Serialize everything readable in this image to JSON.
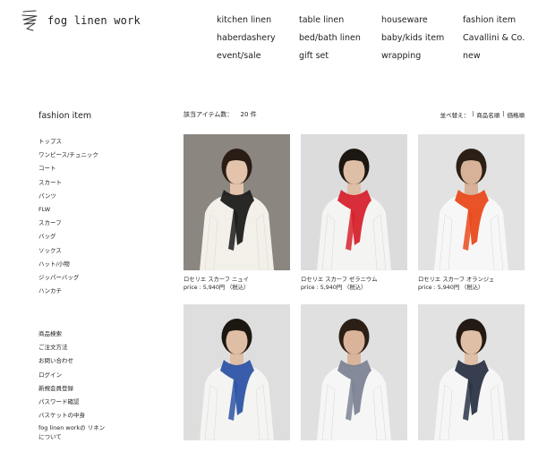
{
  "brand": {
    "name": "fog linen work"
  },
  "nav": [
    "kitchen linen",
    "table linen",
    "houseware",
    "fashion item",
    "haberdashery",
    "bed/bath linen",
    "baby/kids item",
    "Cavallini & Co.",
    "event/sale",
    "gift set",
    "wrapping",
    "new"
  ],
  "sidebar": {
    "title": "fashion item",
    "categories": [
      "トップス",
      "ワンピース/チュニック",
      "コート",
      "スカート",
      "パンツ",
      "FLW",
      "スカーフ",
      "バッグ",
      "ソックス",
      "ハット/小物",
      "ジッパーバッグ",
      "ハンカチ"
    ],
    "utility": [
      "商品検索",
      "ご注文方法",
      "お問い合わせ",
      "ログイン",
      "新規会員登録",
      "パスワード確認",
      "バスケットの中身",
      "fog linen workの リネンについて"
    ]
  },
  "listing": {
    "count_label": "該当アイテム数：",
    "count_value": "20 件",
    "sort_label": "並べ替え：",
    "sort_sep": "|",
    "sort_name": "商品名順",
    "sort_price": "価格順"
  },
  "products": [
    {
      "name": "ロセリエ スカーフ ニュイ",
      "price": "price : 5,940円 （税込）",
      "bg": "#8b8680",
      "shirt": "#f3f0ea",
      "scarf": "#1c1c1c",
      "hair": "#2a1d15",
      "skin": "#e3c3ab",
      "pants": "#f3f0ea"
    },
    {
      "name": "ロセリエ スカーフ ゼラニウム",
      "price": "price : 5,940円 （税込）",
      "bg": "#dcdcdc",
      "shirt": "#f4f4f2",
      "scarf": "#d6232e",
      "hair": "#1d1712",
      "skin": "#dfbea6",
      "pants": "#f4f4f2"
    },
    {
      "name": "ロセリエ スカーフ オランジュ",
      "price": "price : 5,940円 （税込）",
      "bg": "#e2e2e2",
      "shirt": "#f7f7f7",
      "scarf": "#e94a1c",
      "hair": "#2b1f16",
      "skin": "#d7b298",
      "pants": "#3b4b63"
    },
    {
      "name": "",
      "price": "",
      "bg": "#dedede",
      "shirt": "#f4f4f2",
      "scarf": "#2e54a6",
      "hair": "#1d1712",
      "skin": "#dfbea6",
      "pants": "#f4f4f2"
    },
    {
      "name": "",
      "price": "",
      "bg": "#e0e0e0",
      "shirt": "#f6f6f6",
      "scarf": "#7e8495",
      "hair": "#2b1f16",
      "skin": "#d9b49a",
      "pants": "#f6f6f6"
    },
    {
      "name": "",
      "price": "",
      "bg": "#e2e2e2",
      "shirt": "#f6f6f6",
      "scarf": "#2c3446",
      "hair": "#231a14",
      "skin": "#e0bfa7",
      "pants": "#f6f6f6"
    }
  ]
}
